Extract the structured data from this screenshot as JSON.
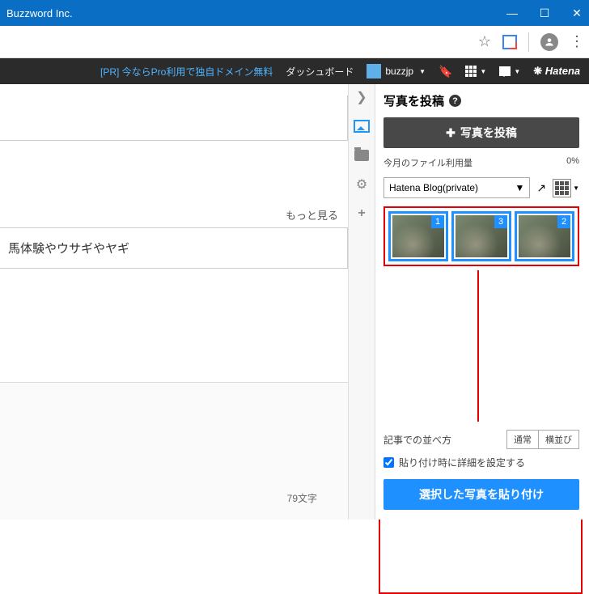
{
  "window": {
    "title": "Buzzword Inc."
  },
  "hatena": {
    "pr": "[PR] 今ならPro利用で独自ドメイン無料",
    "dashboard": "ダッシュボード",
    "user": "buzzjp",
    "brand": "Hatena"
  },
  "editor": {
    "more": "もっと見る",
    "content": "馬体験やウサギやヤギ",
    "char_count": "79文字"
  },
  "panel": {
    "title": "写真を投稿",
    "upload": "写真を投稿",
    "usage_label": "今月のファイル利用量",
    "usage_value": "0%",
    "source": "Hatena Blog(private)",
    "thumbs": [
      {
        "order": "1"
      },
      {
        "order": "3"
      },
      {
        "order": "2"
      }
    ],
    "arrange_label": "記事での並べ方",
    "arrange_normal": "通常",
    "arrange_horiz": "横並び",
    "detail_check": "貼り付け時に詳細を設定する",
    "paste": "選択した写真を貼り付け"
  }
}
